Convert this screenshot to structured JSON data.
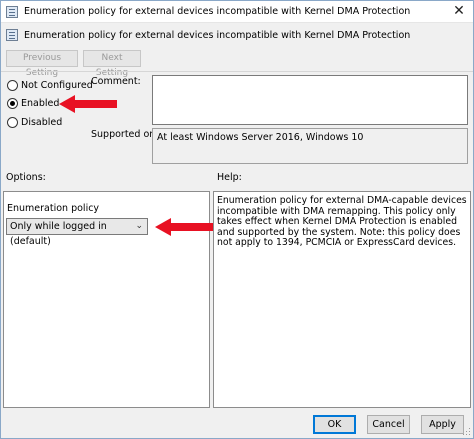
{
  "window": {
    "title": "Enumeration policy for external devices incompatible with Kernel DMA Protection",
    "close_glyph": "✕"
  },
  "header": {
    "title": "Enumeration policy for external devices incompatible with Kernel DMA Protection"
  },
  "nav": {
    "previous_label": "Previous Setting",
    "next_label": "Next Setting"
  },
  "state": {
    "options": [
      {
        "label": "Not Configured",
        "checked": false
      },
      {
        "label": "Enabled",
        "checked": true
      },
      {
        "label": "Disabled",
        "checked": false
      }
    ]
  },
  "comment": {
    "label": "Comment:",
    "value": ""
  },
  "supported": {
    "label": "Supported on:",
    "value": "At least Windows Server 2016, Windows 10"
  },
  "options_panel": {
    "label": "Options:",
    "policy_label": "Enumeration policy",
    "selected_value": "Only while logged in (default)"
  },
  "help_panel": {
    "label": "Help:",
    "text": "Enumeration policy for external DMA-capable devices incompatible with DMA remapping. This policy only takes effect when Kernel DMA Protection is enabled and supported by the system. Note: this policy does not apply to 1394, PCMCIA or ExpressCard devices."
  },
  "buttons": {
    "ok": "OK",
    "cancel": "Cancel",
    "apply": "Apply"
  },
  "annotations": {
    "arrow_color": "#e81123"
  }
}
